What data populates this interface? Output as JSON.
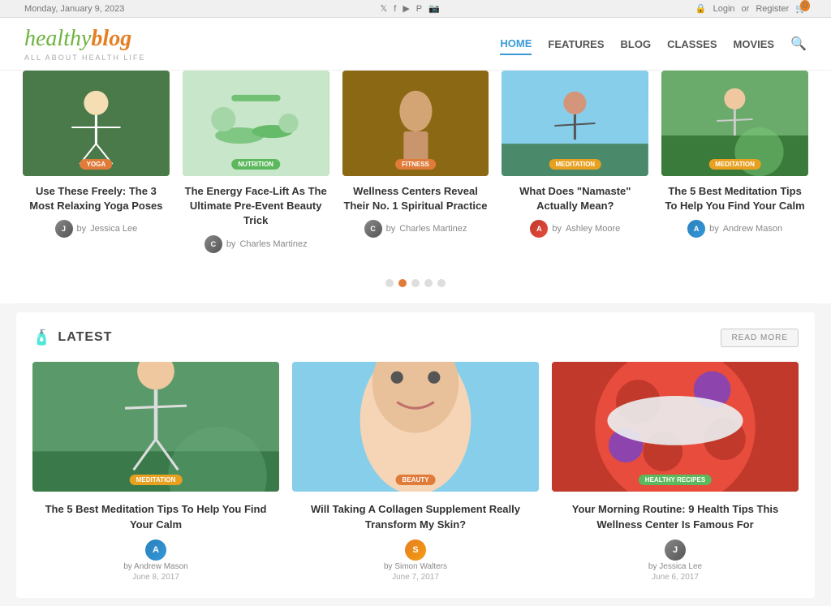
{
  "topbar": {
    "date": "Monday, January 9, 2023",
    "social": [
      "twitter",
      "facebook",
      "youtube",
      "pinterest",
      "instagram"
    ],
    "login_label": "Login",
    "or_label": "or",
    "register_label": "Register",
    "cart_count": "0"
  },
  "header": {
    "logo_healthy": "healthy",
    "logo_blog": "blog",
    "logo_sub": "ALL ABOUT HEALTH LIFE",
    "nav_items": [
      {
        "label": "HOME",
        "active": true
      },
      {
        "label": "FEATURES",
        "active": false
      },
      {
        "label": "BLOG",
        "active": false
      },
      {
        "label": "CLASSES",
        "active": false
      },
      {
        "label": "MOVIES",
        "active": false
      }
    ]
  },
  "carousel": {
    "cards": [
      {
        "category": "YOGA",
        "category_class": "yoga",
        "title": "Use These Freely: The 3 Most Relaxing Yoga Poses",
        "author": "Jessica Lee",
        "avatar_letter": "J"
      },
      {
        "category": "NUTRITION",
        "category_class": "nutrition",
        "title": "The Energy Face-Lift As The Ultimate Pre-Event Beauty Trick",
        "author": "Charles Martinez",
        "avatar_letter": "C"
      },
      {
        "category": "FITNESS",
        "category_class": "fitness",
        "title": "Wellness Centers Reveal Their No. 1 Spiritual Practice",
        "author": "Charles Martinez",
        "avatar_letter": "C"
      },
      {
        "category": "MEDITATION",
        "category_class": "meditation",
        "title": "What Does \"Namaste\" Actually Mean?",
        "author": "Ashley Moore",
        "avatar_letter": "A"
      },
      {
        "category": "MEDITATION",
        "category_class": "meditation",
        "title": "The 5 Best Meditation Tips To Help You Find Your Calm",
        "author": "Andrew Mason",
        "avatar_letter": "A"
      }
    ],
    "dots": [
      false,
      true,
      false,
      false,
      false
    ]
  },
  "latest": {
    "title": "LATEST",
    "read_more": "READ MORE",
    "cards": [
      {
        "category": "MEDITATION",
        "category_class": "meditation",
        "title": "The 5 Best Meditation Tips To Help You Find Your Calm",
        "author": "Andrew Mason",
        "date": "June 8, 2017",
        "avatar_letter": "A",
        "img_class": "img-meditation3"
      },
      {
        "category": "BEAUTY",
        "category_class": "fitness",
        "title": "Will Taking A Collagen Supplement Really Transform My Skin?",
        "author": "Simon Walters",
        "date": "June 7, 2017",
        "avatar_letter": "S",
        "img_class": "img-beauty"
      },
      {
        "category": "HEALTHY RECIPES",
        "category_class": "nutrition",
        "title": "Your Morning Routine: 9 Health Tips This Wellness Center Is Famous For",
        "author": "Jessica Lee",
        "date": "June 6, 2017",
        "avatar_letter": "J",
        "img_class": "img-recipes"
      }
    ]
  }
}
